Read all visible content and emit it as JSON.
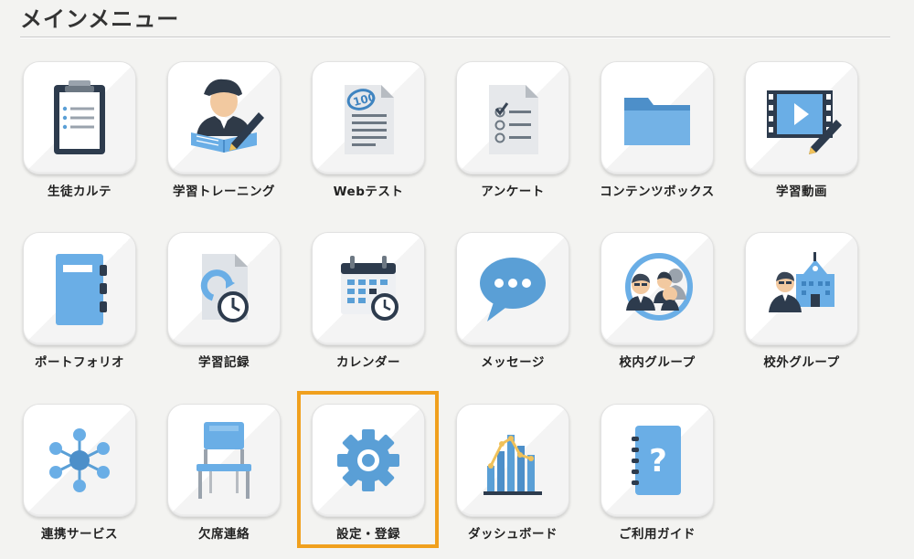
{
  "page": {
    "title": "メインメニュー"
  },
  "menu": {
    "items": [
      {
        "id": "student-karte",
        "label": "生徒カルテ",
        "icon": "clipboard-icon"
      },
      {
        "id": "learning-training",
        "label": "学習トレーニング",
        "icon": "student-writing-icon"
      },
      {
        "id": "web-test",
        "label": "Webテスト",
        "icon": "test-paper-icon"
      },
      {
        "id": "survey",
        "label": "アンケート",
        "icon": "checklist-icon"
      },
      {
        "id": "contents-box",
        "label": "コンテンツボックス",
        "icon": "folder-icon"
      },
      {
        "id": "learning-video",
        "label": "学習動画",
        "icon": "video-pencil-icon"
      },
      {
        "id": "portfolio",
        "label": "ポートフォリオ",
        "icon": "binder-icon"
      },
      {
        "id": "learning-record",
        "label": "学習記録",
        "icon": "document-clock-icon"
      },
      {
        "id": "calendar",
        "label": "カレンダー",
        "icon": "calendar-icon"
      },
      {
        "id": "message",
        "label": "メッセージ",
        "icon": "speech-bubble-icon"
      },
      {
        "id": "in-school-group",
        "label": "校内グループ",
        "icon": "group-people-icon"
      },
      {
        "id": "out-school-group",
        "label": "校外グループ",
        "icon": "school-people-icon"
      },
      {
        "id": "linked-service",
        "label": "連携サービス",
        "icon": "network-icon"
      },
      {
        "id": "absence-contact",
        "label": "欠席連絡",
        "icon": "chair-icon"
      },
      {
        "id": "settings-registration",
        "label": "設定・登録",
        "icon": "gear-icon"
      },
      {
        "id": "dashboard",
        "label": "ダッシュボード",
        "icon": "bar-chart-icon"
      },
      {
        "id": "user-guide",
        "label": "ご利用ガイド",
        "icon": "help-book-icon"
      }
    ],
    "highlighted_item": "設定・登録"
  },
  "colors": {
    "highlight": "#f0a01e",
    "icon_blue": "#5a9fd6",
    "icon_dark": "#2d3b4d"
  }
}
